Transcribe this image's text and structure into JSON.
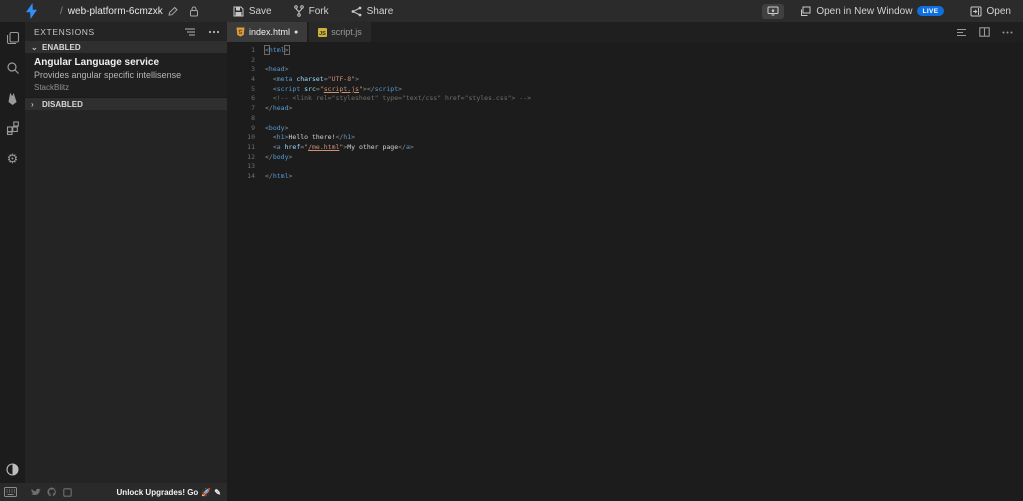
{
  "topbar": {
    "project_prefix": "/",
    "project_name": "web-platform-6cmzxk",
    "save_label": "Save",
    "fork_label": "Fork",
    "share_label": "Share",
    "open_new_window_label": "Open in New Window",
    "live_badge": "LIVE",
    "open_label": "Open"
  },
  "extensions_panel": {
    "title": "EXTENSIONS",
    "enabled_label": "ENABLED",
    "disabled_label": "DISABLED",
    "enabled_chevron": "⌄",
    "disabled_chevron": "›",
    "extension": {
      "name": "Angular Language service",
      "description": "Provides angular specific intellisense",
      "publisher": "StackBlitz"
    }
  },
  "tabs": [
    {
      "label": "index.html",
      "modified": "●"
    },
    {
      "label": "script.js"
    }
  ],
  "editor": {
    "lines": [
      [
        [
          "punct boxed",
          "<"
        ],
        [
          "tag",
          "html"
        ],
        [
          "punct boxed",
          ">"
        ]
      ],
      [],
      [
        [
          "punct",
          "<"
        ],
        [
          "tag",
          "head"
        ],
        [
          "punct",
          ">"
        ]
      ],
      [
        [
          "plain",
          "  "
        ],
        [
          "punct",
          "<"
        ],
        [
          "tag",
          "meta"
        ],
        [
          "plain",
          " "
        ],
        [
          "attr",
          "charset"
        ],
        [
          "punct",
          "="
        ],
        [
          "str",
          "\"UTF-8\""
        ],
        [
          "punct",
          ">"
        ]
      ],
      [
        [
          "plain",
          "  "
        ],
        [
          "punct",
          "<"
        ],
        [
          "tag",
          "script"
        ],
        [
          "plain",
          " "
        ],
        [
          "attr",
          "src"
        ],
        [
          "punct",
          "="
        ],
        [
          "str",
          "\""
        ],
        [
          "str link",
          "script.js"
        ],
        [
          "str",
          "\""
        ],
        [
          "punct",
          "></"
        ],
        [
          "tag",
          "script"
        ],
        [
          "punct",
          ">"
        ]
      ],
      [
        [
          "plain",
          "  "
        ],
        [
          "comment",
          "<!-- <link rel=\"stylesheet\" type=\"text/css\" href=\"styles.css\"> -->"
        ]
      ],
      [
        [
          "punct",
          "</"
        ],
        [
          "tag",
          "head"
        ],
        [
          "punct",
          ">"
        ]
      ],
      [],
      [
        [
          "punct",
          "<"
        ],
        [
          "tag",
          "body"
        ],
        [
          "punct",
          ">"
        ]
      ],
      [
        [
          "plain",
          "  "
        ],
        [
          "punct",
          "<"
        ],
        [
          "tag",
          "h1"
        ],
        [
          "punct",
          ">"
        ],
        [
          "plain",
          "Hello there!"
        ],
        [
          "punct",
          "</"
        ],
        [
          "tag",
          "h1"
        ],
        [
          "punct",
          ">"
        ]
      ],
      [
        [
          "plain",
          "  "
        ],
        [
          "punct",
          "<"
        ],
        [
          "tag",
          "a"
        ],
        [
          "plain",
          " "
        ],
        [
          "attr",
          "href"
        ],
        [
          "punct",
          "="
        ],
        [
          "str",
          "\""
        ],
        [
          "str link",
          "/me.html"
        ],
        [
          "str",
          "\""
        ],
        [
          "punct",
          ">"
        ],
        [
          "plain",
          "My other page"
        ],
        [
          "punct",
          "</"
        ],
        [
          "tag",
          "a"
        ],
        [
          "punct",
          ">"
        ]
      ],
      [
        [
          "punct",
          "</"
        ],
        [
          "tag",
          "body"
        ],
        [
          "punct",
          ">"
        ]
      ],
      [],
      [
        [
          "punct",
          "</"
        ],
        [
          "tag",
          "html"
        ],
        [
          "punct",
          ">"
        ]
      ]
    ]
  },
  "status_bar": {
    "upgrade_label": "Unlock Upgrades! Go",
    "rocket_emoji": "🚀",
    "pencil_glyph": "✎"
  },
  "colors": {
    "accent": "#338ef7",
    "live_badge": "#0f6fde",
    "tag": "#569cd6",
    "attribute": "#9cdcfe",
    "string": "#ce9178",
    "comment": "#6b7468",
    "html_icon": "#e09c3c",
    "js_icon": "#ccb23d"
  }
}
